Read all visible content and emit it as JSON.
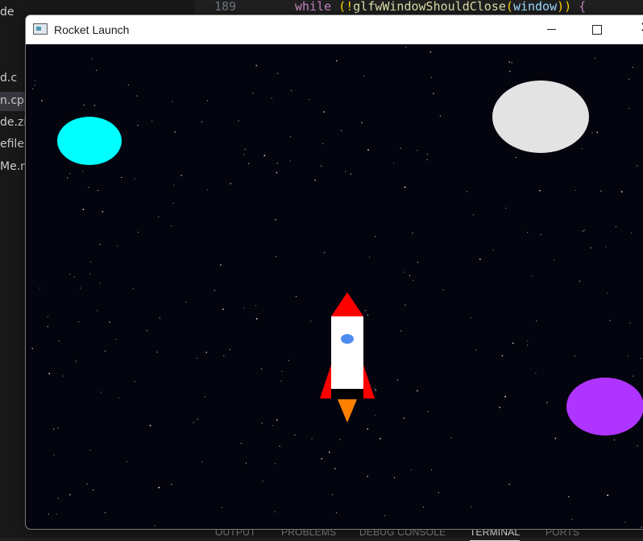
{
  "background_editor": {
    "explorer_items": [
      "de",
      "d.c",
      "n.cp",
      "de.zi",
      "efile",
      "Me.r"
    ],
    "code_line_number": "189",
    "code": {
      "kw_while": "while",
      "open": " (!",
      "fn_name": "glfwWindowShouldClose",
      "paren_open": "(",
      "arg": "window",
      "paren_close": "))",
      "brace": " {"
    },
    "panel_tabs": [
      "OUTPUT",
      "PROBLEMS",
      "DEBUG CONSOLE",
      "TERMINAL",
      "PORTS"
    ],
    "active_panel_tab": "TERMINAL"
  },
  "window": {
    "title": "Rocket Launch",
    "controls": [
      "minimize",
      "maximize",
      "close"
    ]
  },
  "scene": {
    "background_color": "#04040f",
    "planets": [
      {
        "name": "cyan-planet",
        "color": "#00ffff"
      },
      {
        "name": "white-planet",
        "color": "#e3e3e3"
      },
      {
        "name": "purple-planet",
        "color": "#b034ff"
      }
    ],
    "rocket": {
      "nose_color": "#ff0000",
      "body_color": "#ffffff",
      "window_color": "#4f8cf0",
      "fin_color": "#ff0000",
      "base_color": "#000000",
      "flame_color": "#ff8000"
    },
    "star_color": "#ffffff"
  }
}
